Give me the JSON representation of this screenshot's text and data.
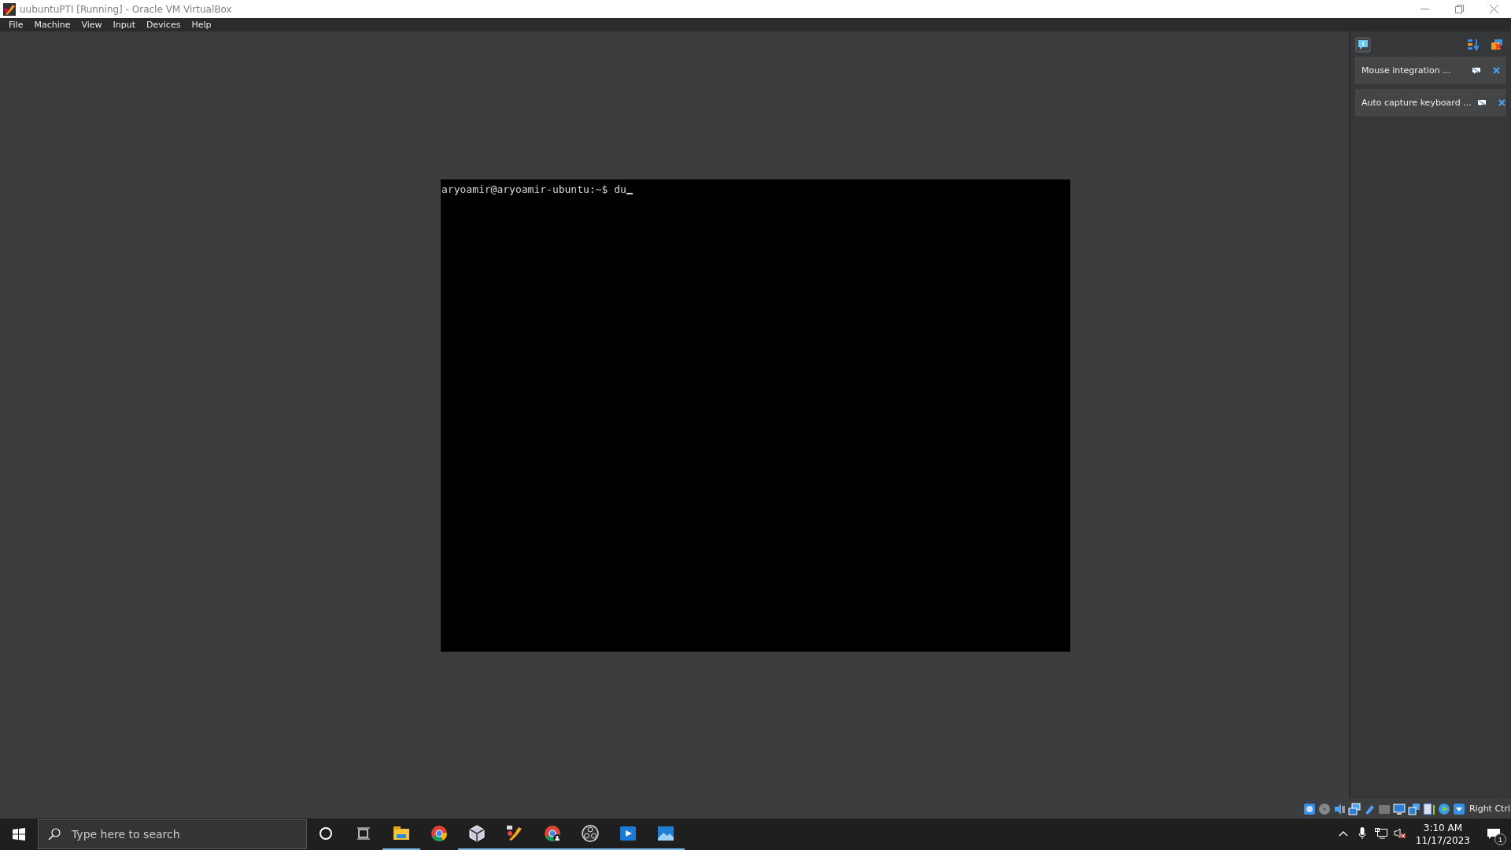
{
  "window": {
    "title": "uubuntuPTI [Running] - Oracle VM VirtualBox"
  },
  "menu": [
    "File",
    "Machine",
    "View",
    "Input",
    "Devices",
    "Help"
  ],
  "terminal": {
    "prompt": "aryoamir@aryoamir-ubuntu:~$ du"
  },
  "notifications": [
    {
      "text": "Mouse integration ..."
    },
    {
      "text": "Auto capture keyboard ..."
    }
  ],
  "status_bar": {
    "host_key": "Right Ctrl"
  },
  "taskbar": {
    "search": {
      "placeholder": "Type here to search"
    },
    "apps": [
      {
        "kind": "explorer",
        "open": true
      },
      {
        "kind": "chrome",
        "open": false
      },
      {
        "kind": "virtualbox",
        "open": true
      },
      {
        "kind": "editor",
        "open": true
      },
      {
        "kind": "chrome-profile",
        "open": true
      },
      {
        "kind": "obs",
        "open": true
      },
      {
        "kind": "video",
        "open": true
      },
      {
        "kind": "photos",
        "open": true
      }
    ],
    "time": "3:10 AM",
    "date": "11/17/2023",
    "notification_count": "1"
  }
}
